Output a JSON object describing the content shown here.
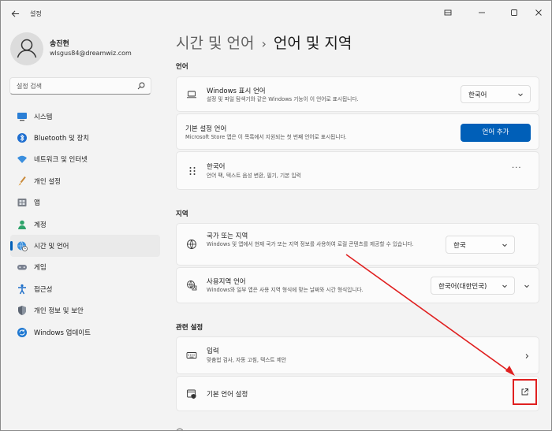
{
  "window": {
    "title": "설정",
    "controls": [
      "minimize",
      "maximize",
      "close"
    ]
  },
  "profile": {
    "name": "송진현",
    "email": "wlsgus84@dreamwiz.com"
  },
  "search": {
    "placeholder": "설정 검색"
  },
  "sidebar": {
    "items": [
      {
        "label": "시스템",
        "icon": "monitor-icon"
      },
      {
        "label": "Bluetooth 및 장치",
        "icon": "bluetooth-icon"
      },
      {
        "label": "네트워크 및 인터넷",
        "icon": "wifi-icon"
      },
      {
        "label": "개인 설정",
        "icon": "brush-icon"
      },
      {
        "label": "앱",
        "icon": "apps-icon"
      },
      {
        "label": "계정",
        "icon": "person-icon"
      },
      {
        "label": "시간 및 언어",
        "icon": "globe-clock-icon",
        "active": true
      },
      {
        "label": "게임",
        "icon": "gamepad-icon"
      },
      {
        "label": "접근성",
        "icon": "accessibility-icon"
      },
      {
        "label": "개인 정보 및 보안",
        "icon": "shield-icon"
      },
      {
        "label": "Windows 업데이트",
        "icon": "update-icon"
      }
    ]
  },
  "breadcrumb": {
    "parent": "시간 및 언어",
    "separator": "›",
    "current": "언어 및 지역"
  },
  "sections": {
    "language": "언어",
    "region": "지역",
    "related": "관련 설정"
  },
  "language_cards": {
    "display": {
      "title": "Windows 표시 언어",
      "desc": "설정 및 파일 탐색기와 같은 Windows 기능이 이 언어로 표시됩니다.",
      "value": "한국어"
    },
    "preferred": {
      "title": "기본 설정 언어",
      "desc": "Microsoft Store 앱은 이 목록에서 지원되는 첫 번째 언어로 표시됩니다.",
      "button": "언어 추가"
    },
    "korean": {
      "title": "한국어",
      "desc": "언어 팩, 텍스트 음성 변환, 필기, 기본 입력",
      "more": "···"
    }
  },
  "region_cards": {
    "country": {
      "title": "국가 또는 지역",
      "desc": "Windows 및 앱에서 현재 국가 또는 지역 정보를 사용하여 로컬 콘텐츠를 제공할 수 있습니다.",
      "value": "한국"
    },
    "format": {
      "title": "사용지역 언어",
      "desc": "Windows와 일부 앱은 사용 지역 형식에 맞는 날짜와 시간 형식입니다.",
      "value": "한국어(대한민국)"
    }
  },
  "related_cards": {
    "typing": {
      "title": "입력",
      "desc": "맞춤법 검사, 자동 고침, 텍스트 제안"
    },
    "admin": {
      "title": "기본 언어 설정"
    }
  },
  "colors": {
    "accent": "#005fb8",
    "annotation": "#e02020",
    "background": "#f3f3f3",
    "card": "#fbfbfb"
  }
}
